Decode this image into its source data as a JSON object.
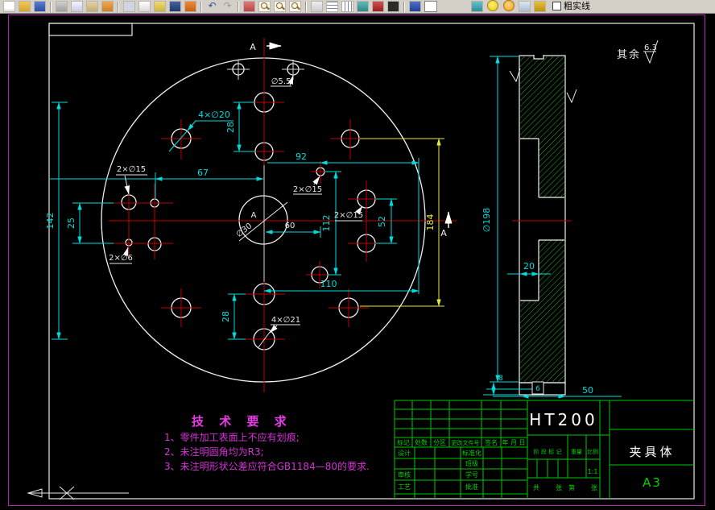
{
  "toolbar": {
    "layer_name": "粗实线",
    "icons": [
      "new-icon",
      "open-icon",
      "save-icon",
      "print-icon",
      "print-preview-icon",
      "plot-stamp-icon",
      "brush-icon",
      "cut-icon",
      "copy-icon",
      "paste-icon",
      "pen-icon",
      "match-properties-icon",
      "undo-icon",
      "redo-icon",
      "erase-icon",
      "zoom-realtime-icon",
      "zoom-window-icon",
      "zoom-previous-icon",
      "zoom-extents-icon",
      "text-icon",
      "table-icon",
      "dimension-icon",
      "layers-icon",
      "screen-icon",
      "grid-icon",
      "help-icon",
      "layer-stack-icon",
      "layer-on-icon",
      "layer-sun-icon",
      "layer-freeze-icon",
      "layer-color-icon"
    ]
  },
  "drawing": {
    "surface_note": "其余",
    "surface_roughness": "6.3",
    "section_label_top": "A",
    "section_label_right": "A",
    "datum_label": "A",
    "dims": {
      "top_hole_callout": "∅5.5",
      "bolt4_callout": "4×∅20",
      "d28_top": "28",
      "d92": "92",
      "d67": "67",
      "callout_2x15_left": "2×∅15",
      "callout_2x15_mid": "2×∅15",
      "callout_2x15_right": "2×∅15",
      "d142": "142",
      "d25": "25",
      "callout_2x6": "2×∅6",
      "center_dia": "∅30",
      "d60": "60",
      "d112": "112",
      "d52": "52",
      "d110": "110",
      "d28_bottom": "28",
      "callout_4x21": "4×∅21",
      "d184": "184",
      "side_dia": "∅198",
      "d20": "20",
      "d8": "8",
      "d6": "6",
      "d50": "50"
    }
  },
  "tech_requirements": {
    "title": "技 术 要 求",
    "items": [
      "1、零件加工表面上不应有划痕;",
      "2、未注明圆角均为R3;",
      "3、未注明形状公差应符合GB1184—80的要求."
    ]
  },
  "title_block": {
    "material": "HT200",
    "part_name": "夹具体",
    "paper_size": "A3",
    "scale_value": "1:1",
    "header_cells": [
      "标记",
      "处数",
      "分区",
      "更改文件号",
      "签名",
      "年 月 日"
    ],
    "row_design": "设计",
    "row_check": "审核",
    "row_process": "工艺",
    "row_standard": "标准化",
    "row_class": "班级",
    "row_number": "学号",
    "row_approve": "批准",
    "stage_mark": "阶 段 标 记",
    "weight_label": "重量",
    "scale_label": "比例",
    "sheet_total_label": "共",
    "sheet_unit1": "张",
    "sheet_no_label": "第",
    "sheet_unit2": "张"
  }
}
